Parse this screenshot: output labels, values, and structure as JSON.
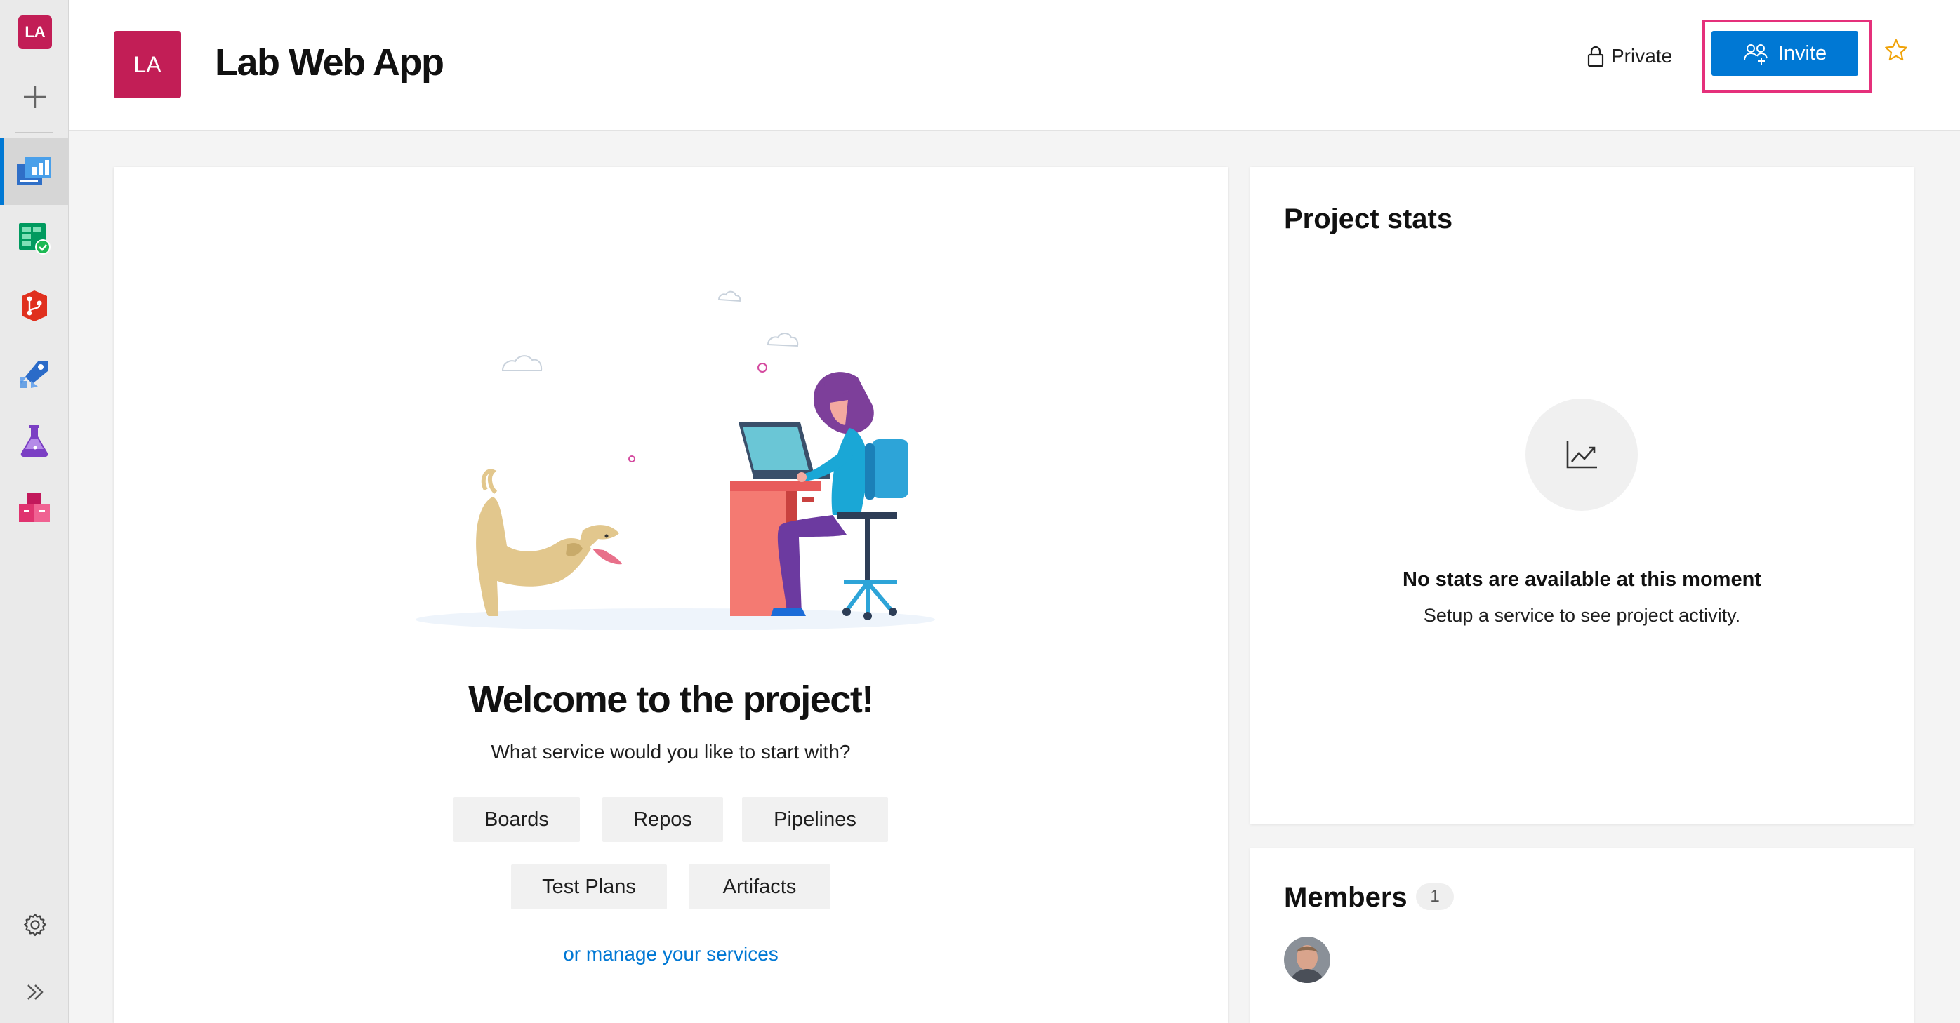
{
  "rail": {
    "org_initials": "LA",
    "items": [
      {
        "name": "overview",
        "icon": "overview-icon"
      },
      {
        "name": "boards",
        "icon": "boards-icon"
      },
      {
        "name": "repos",
        "icon": "repos-icon"
      },
      {
        "name": "pipelines",
        "icon": "pipelines-icon"
      },
      {
        "name": "test-plans",
        "icon": "test-plans-icon"
      },
      {
        "name": "artifacts",
        "icon": "artifacts-icon"
      }
    ],
    "settings_icon": "gear-icon",
    "expand_icon": "double-chevron-right-icon"
  },
  "header": {
    "project_initials": "LA",
    "project_name": "Lab Web App",
    "visibility": "Private",
    "invite_label": "Invite",
    "colors": {
      "accent": "#0078d4",
      "project": "#c21e56",
      "highlight": "#e5307b",
      "star": "#f0a30a"
    }
  },
  "welcome": {
    "title": "Welcome to the project!",
    "subtitle": "What service would you like to start with?",
    "services_row1": [
      "Boards",
      "Repos",
      "Pipelines"
    ],
    "services_row2": [
      "Test Plans",
      "Artifacts"
    ],
    "manage_link": "or manage your services"
  },
  "stats": {
    "title": "Project stats",
    "empty_title": "No stats are available at this moment",
    "empty_subtitle": "Setup a service to see project activity."
  },
  "members": {
    "title": "Members",
    "count": "1"
  }
}
